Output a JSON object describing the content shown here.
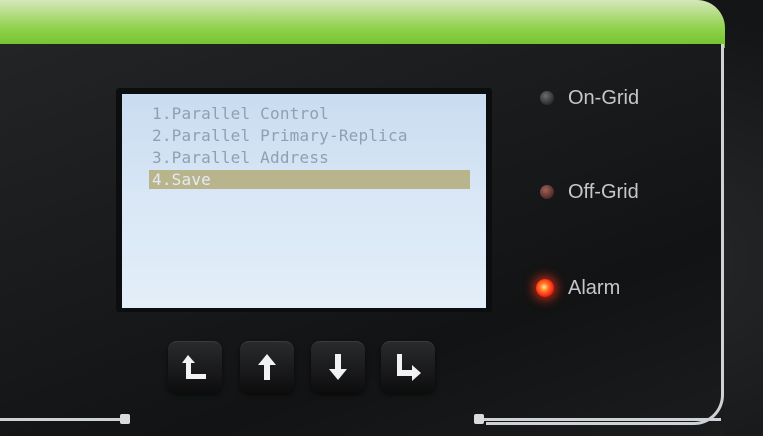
{
  "lcd": {
    "menu": [
      {
        "label": "1.Parallel Control",
        "selected": false
      },
      {
        "label": "2.Parallel Primary-Replica",
        "selected": false
      },
      {
        "label": "3.Parallel Address",
        "selected": false
      },
      {
        "label": "4.Save",
        "selected": true
      }
    ]
  },
  "indicators": {
    "on_grid": {
      "label": "On-Grid",
      "state": "off",
      "color": "#3a3c3d"
    },
    "off_grid": {
      "label": "Off-Grid",
      "state": "off",
      "color": "#6b3a35"
    },
    "alarm": {
      "label": "Alarm",
      "state": "on",
      "color": "#ff2a1a"
    }
  },
  "keypad": {
    "buttons": [
      {
        "name": "back-button",
        "icon": "return-up-left-icon"
      },
      {
        "name": "up-button",
        "icon": "arrow-up-icon"
      },
      {
        "name": "down-button",
        "icon": "arrow-down-icon"
      },
      {
        "name": "enter-button",
        "icon": "return-down-right-icon"
      }
    ]
  },
  "colors": {
    "brand_green": "#6fc12d",
    "lcd_background": "#d9e7f6",
    "lcd_selection": "#b8b58c"
  }
}
